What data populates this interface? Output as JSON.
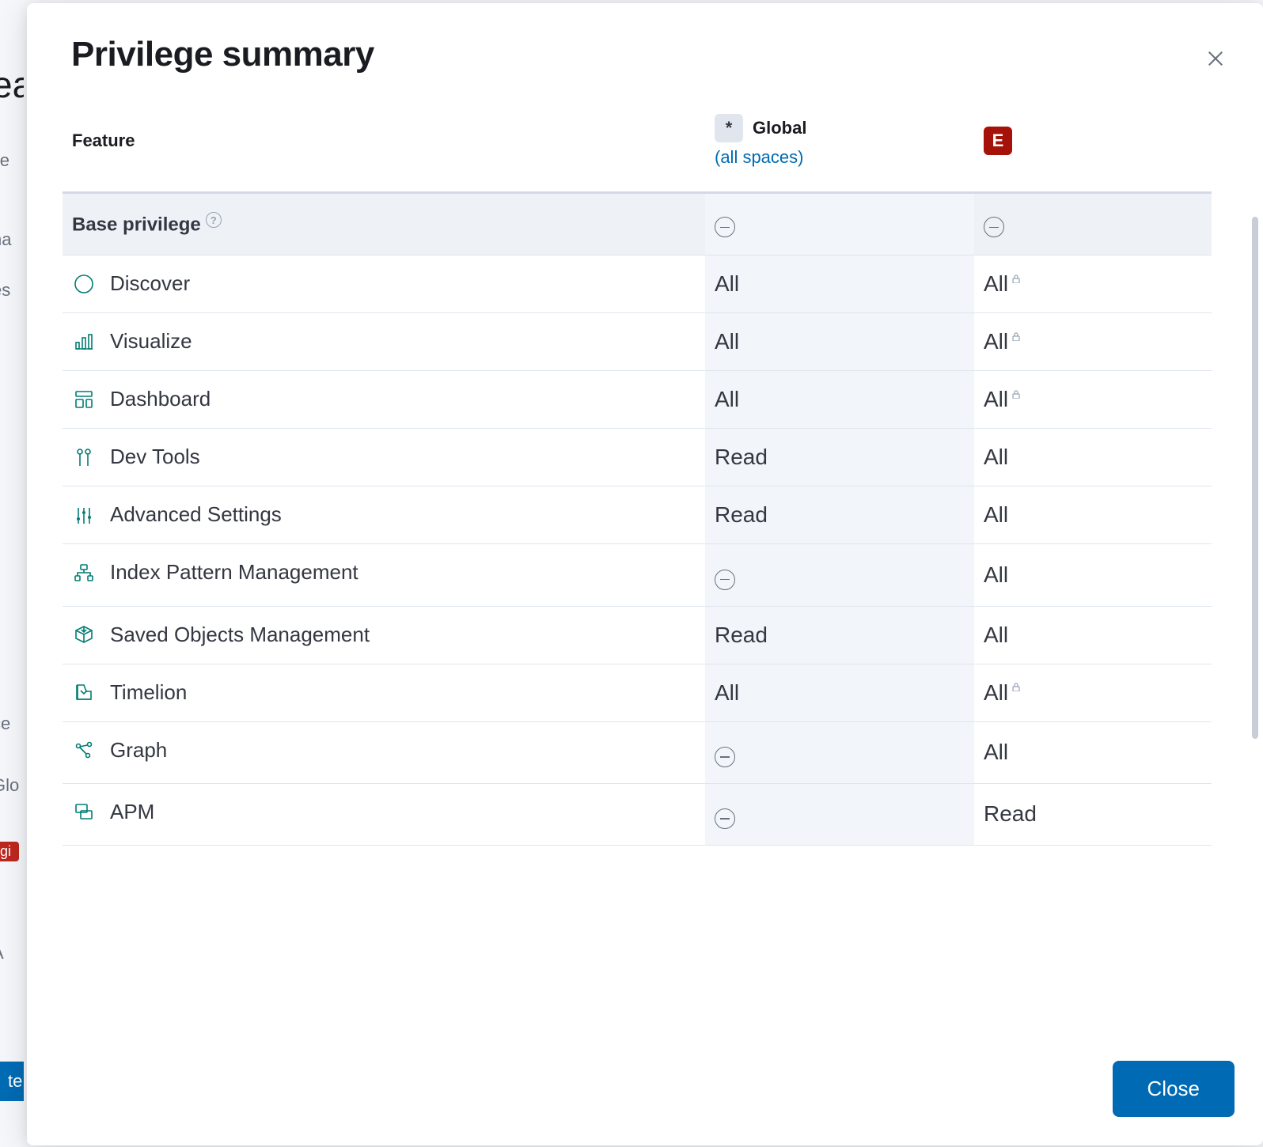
{
  "modal": {
    "title": "Privilege summary",
    "close_label": "Close"
  },
  "columns": {
    "feature_header": "Feature",
    "global": {
      "badge": "*",
      "label": "Global",
      "sublabel": "(all spaces)"
    },
    "space_e": {
      "badge": "E",
      "label": ""
    }
  },
  "base_row": {
    "label": "Base privilege",
    "global": "minus",
    "e": "minus"
  },
  "features": [
    {
      "icon": "compass",
      "name": "Discover",
      "global": "All",
      "global_minus": false,
      "e": "All",
      "e_lock": true
    },
    {
      "icon": "visualize",
      "name": "Visualize",
      "global": "All",
      "global_minus": false,
      "e": "All",
      "e_lock": true
    },
    {
      "icon": "dashboard",
      "name": "Dashboard",
      "global": "All",
      "global_minus": false,
      "e": "All",
      "e_lock": true
    },
    {
      "icon": "devtools",
      "name": "Dev Tools",
      "global": "Read",
      "global_minus": false,
      "e": "All",
      "e_lock": false
    },
    {
      "icon": "advanced",
      "name": "Advanced Settings",
      "global": "Read",
      "global_minus": false,
      "e": "All",
      "e_lock": false
    },
    {
      "icon": "index",
      "name": "Index Pattern Management",
      "global": "",
      "global_minus": true,
      "e": "All",
      "e_lock": false
    },
    {
      "icon": "saved",
      "name": "Saved Objects Management",
      "global": "Read",
      "global_minus": false,
      "e": "All",
      "e_lock": false
    },
    {
      "icon": "timelion",
      "name": "Timelion",
      "global": "All",
      "global_minus": false,
      "e": "All",
      "e_lock": true
    },
    {
      "icon": "graph",
      "name": "Graph",
      "global": "",
      "global_minus": true,
      "e": "All",
      "e_lock": false
    },
    {
      "icon": "apm",
      "name": "APM",
      "global": "",
      "global_minus": true,
      "e": "Read",
      "e_lock": false
    }
  ],
  "background": {
    "h1": "ea",
    "h2": "ile",
    "h3": "na",
    "h4": "es",
    "h5": "ce",
    "h6": "Glo",
    "h7": "A",
    "badge": "gi",
    "btn": "te"
  }
}
